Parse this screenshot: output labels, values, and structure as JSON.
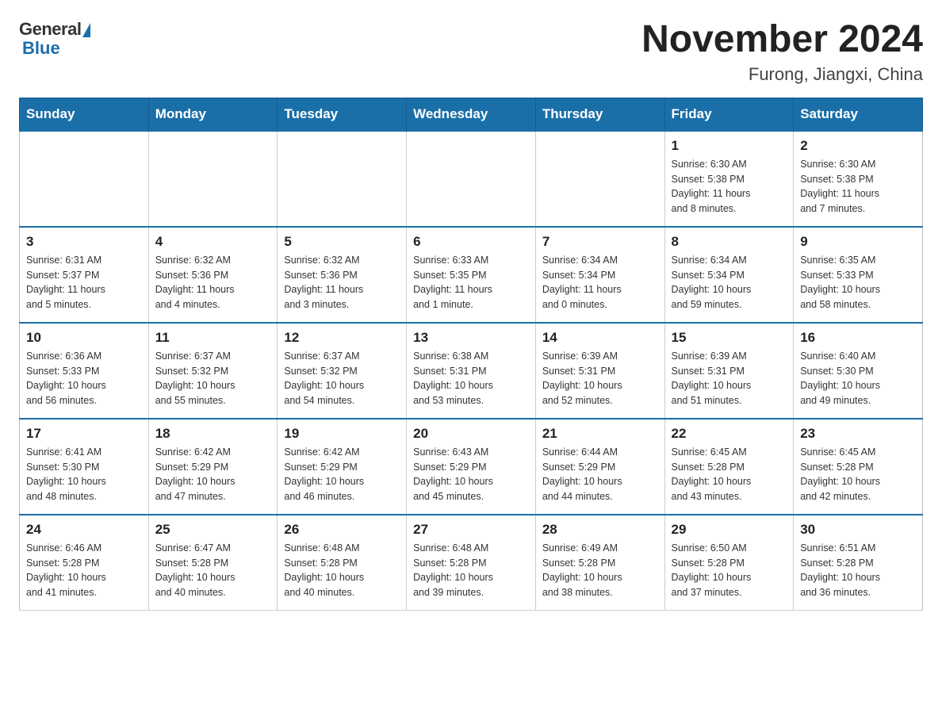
{
  "logo": {
    "general": "General",
    "blue": "Blue"
  },
  "title": "November 2024",
  "subtitle": "Furong, Jiangxi, China",
  "weekdays": [
    "Sunday",
    "Monday",
    "Tuesday",
    "Wednesday",
    "Thursday",
    "Friday",
    "Saturday"
  ],
  "weeks": [
    [
      {
        "day": "",
        "info": ""
      },
      {
        "day": "",
        "info": ""
      },
      {
        "day": "",
        "info": ""
      },
      {
        "day": "",
        "info": ""
      },
      {
        "day": "",
        "info": ""
      },
      {
        "day": "1",
        "info": "Sunrise: 6:30 AM\nSunset: 5:38 PM\nDaylight: 11 hours\nand 8 minutes."
      },
      {
        "day": "2",
        "info": "Sunrise: 6:30 AM\nSunset: 5:38 PM\nDaylight: 11 hours\nand 7 minutes."
      }
    ],
    [
      {
        "day": "3",
        "info": "Sunrise: 6:31 AM\nSunset: 5:37 PM\nDaylight: 11 hours\nand 5 minutes."
      },
      {
        "day": "4",
        "info": "Sunrise: 6:32 AM\nSunset: 5:36 PM\nDaylight: 11 hours\nand 4 minutes."
      },
      {
        "day": "5",
        "info": "Sunrise: 6:32 AM\nSunset: 5:36 PM\nDaylight: 11 hours\nand 3 minutes."
      },
      {
        "day": "6",
        "info": "Sunrise: 6:33 AM\nSunset: 5:35 PM\nDaylight: 11 hours\nand 1 minute."
      },
      {
        "day": "7",
        "info": "Sunrise: 6:34 AM\nSunset: 5:34 PM\nDaylight: 11 hours\nand 0 minutes."
      },
      {
        "day": "8",
        "info": "Sunrise: 6:34 AM\nSunset: 5:34 PM\nDaylight: 10 hours\nand 59 minutes."
      },
      {
        "day": "9",
        "info": "Sunrise: 6:35 AM\nSunset: 5:33 PM\nDaylight: 10 hours\nand 58 minutes."
      }
    ],
    [
      {
        "day": "10",
        "info": "Sunrise: 6:36 AM\nSunset: 5:33 PM\nDaylight: 10 hours\nand 56 minutes."
      },
      {
        "day": "11",
        "info": "Sunrise: 6:37 AM\nSunset: 5:32 PM\nDaylight: 10 hours\nand 55 minutes."
      },
      {
        "day": "12",
        "info": "Sunrise: 6:37 AM\nSunset: 5:32 PM\nDaylight: 10 hours\nand 54 minutes."
      },
      {
        "day": "13",
        "info": "Sunrise: 6:38 AM\nSunset: 5:31 PM\nDaylight: 10 hours\nand 53 minutes."
      },
      {
        "day": "14",
        "info": "Sunrise: 6:39 AM\nSunset: 5:31 PM\nDaylight: 10 hours\nand 52 minutes."
      },
      {
        "day": "15",
        "info": "Sunrise: 6:39 AM\nSunset: 5:31 PM\nDaylight: 10 hours\nand 51 minutes."
      },
      {
        "day": "16",
        "info": "Sunrise: 6:40 AM\nSunset: 5:30 PM\nDaylight: 10 hours\nand 49 minutes."
      }
    ],
    [
      {
        "day": "17",
        "info": "Sunrise: 6:41 AM\nSunset: 5:30 PM\nDaylight: 10 hours\nand 48 minutes."
      },
      {
        "day": "18",
        "info": "Sunrise: 6:42 AM\nSunset: 5:29 PM\nDaylight: 10 hours\nand 47 minutes."
      },
      {
        "day": "19",
        "info": "Sunrise: 6:42 AM\nSunset: 5:29 PM\nDaylight: 10 hours\nand 46 minutes."
      },
      {
        "day": "20",
        "info": "Sunrise: 6:43 AM\nSunset: 5:29 PM\nDaylight: 10 hours\nand 45 minutes."
      },
      {
        "day": "21",
        "info": "Sunrise: 6:44 AM\nSunset: 5:29 PM\nDaylight: 10 hours\nand 44 minutes."
      },
      {
        "day": "22",
        "info": "Sunrise: 6:45 AM\nSunset: 5:28 PM\nDaylight: 10 hours\nand 43 minutes."
      },
      {
        "day": "23",
        "info": "Sunrise: 6:45 AM\nSunset: 5:28 PM\nDaylight: 10 hours\nand 42 minutes."
      }
    ],
    [
      {
        "day": "24",
        "info": "Sunrise: 6:46 AM\nSunset: 5:28 PM\nDaylight: 10 hours\nand 41 minutes."
      },
      {
        "day": "25",
        "info": "Sunrise: 6:47 AM\nSunset: 5:28 PM\nDaylight: 10 hours\nand 40 minutes."
      },
      {
        "day": "26",
        "info": "Sunrise: 6:48 AM\nSunset: 5:28 PM\nDaylight: 10 hours\nand 40 minutes."
      },
      {
        "day": "27",
        "info": "Sunrise: 6:48 AM\nSunset: 5:28 PM\nDaylight: 10 hours\nand 39 minutes."
      },
      {
        "day": "28",
        "info": "Sunrise: 6:49 AM\nSunset: 5:28 PM\nDaylight: 10 hours\nand 38 minutes."
      },
      {
        "day": "29",
        "info": "Sunrise: 6:50 AM\nSunset: 5:28 PM\nDaylight: 10 hours\nand 37 minutes."
      },
      {
        "day": "30",
        "info": "Sunrise: 6:51 AM\nSunset: 5:28 PM\nDaylight: 10 hours\nand 36 minutes."
      }
    ]
  ]
}
